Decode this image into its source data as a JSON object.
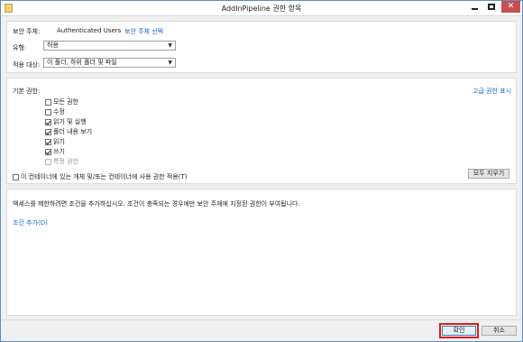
{
  "window": {
    "title": "AddInPipeline 권한 항목"
  },
  "principal": {
    "label": "보안 주체:",
    "value": "Authenticated Users",
    "select_link": "보안 주체 선택"
  },
  "type": {
    "label": "유형:",
    "value": "허용"
  },
  "applies_to": {
    "label": "적용 대상:",
    "value": "이 폴더, 하위 폴더 및 파일"
  },
  "basic_permissions": {
    "label": "기본 권한:",
    "advanced_link": "고급 권한 표시",
    "items": [
      {
        "label": "모든 권한",
        "checked": false,
        "disabled": false
      },
      {
        "label": "수정",
        "checked": false,
        "disabled": false
      },
      {
        "label": "읽기 및 실행",
        "checked": true,
        "disabled": false
      },
      {
        "label": "폴더 내용 보기",
        "checked": true,
        "disabled": false
      },
      {
        "label": "읽기",
        "checked": true,
        "disabled": false
      },
      {
        "label": "쓰기",
        "checked": true,
        "disabled": false
      },
      {
        "label": "특정 권한",
        "checked": false,
        "disabled": true
      }
    ],
    "apply_only_label": "이 컨테이너에 있는 개체 및/또는 컨테이너에 사용 권한 적용(T)",
    "clear_all_button": "모두 지우기"
  },
  "conditions": {
    "description": "액세스를 제한하려면 조건을 추가하십시오. 조건이 충족되는 경우에만 보안 주체에 지정된 권한이 부여됩니다.",
    "add_link": "조건 추가(D)"
  },
  "footer": {
    "ok_button": "확인",
    "cancel_button": "취소"
  },
  "colors": {
    "link": "#1a66c4",
    "close_button": "#c75050",
    "highlight_outline": "#d9201e"
  }
}
